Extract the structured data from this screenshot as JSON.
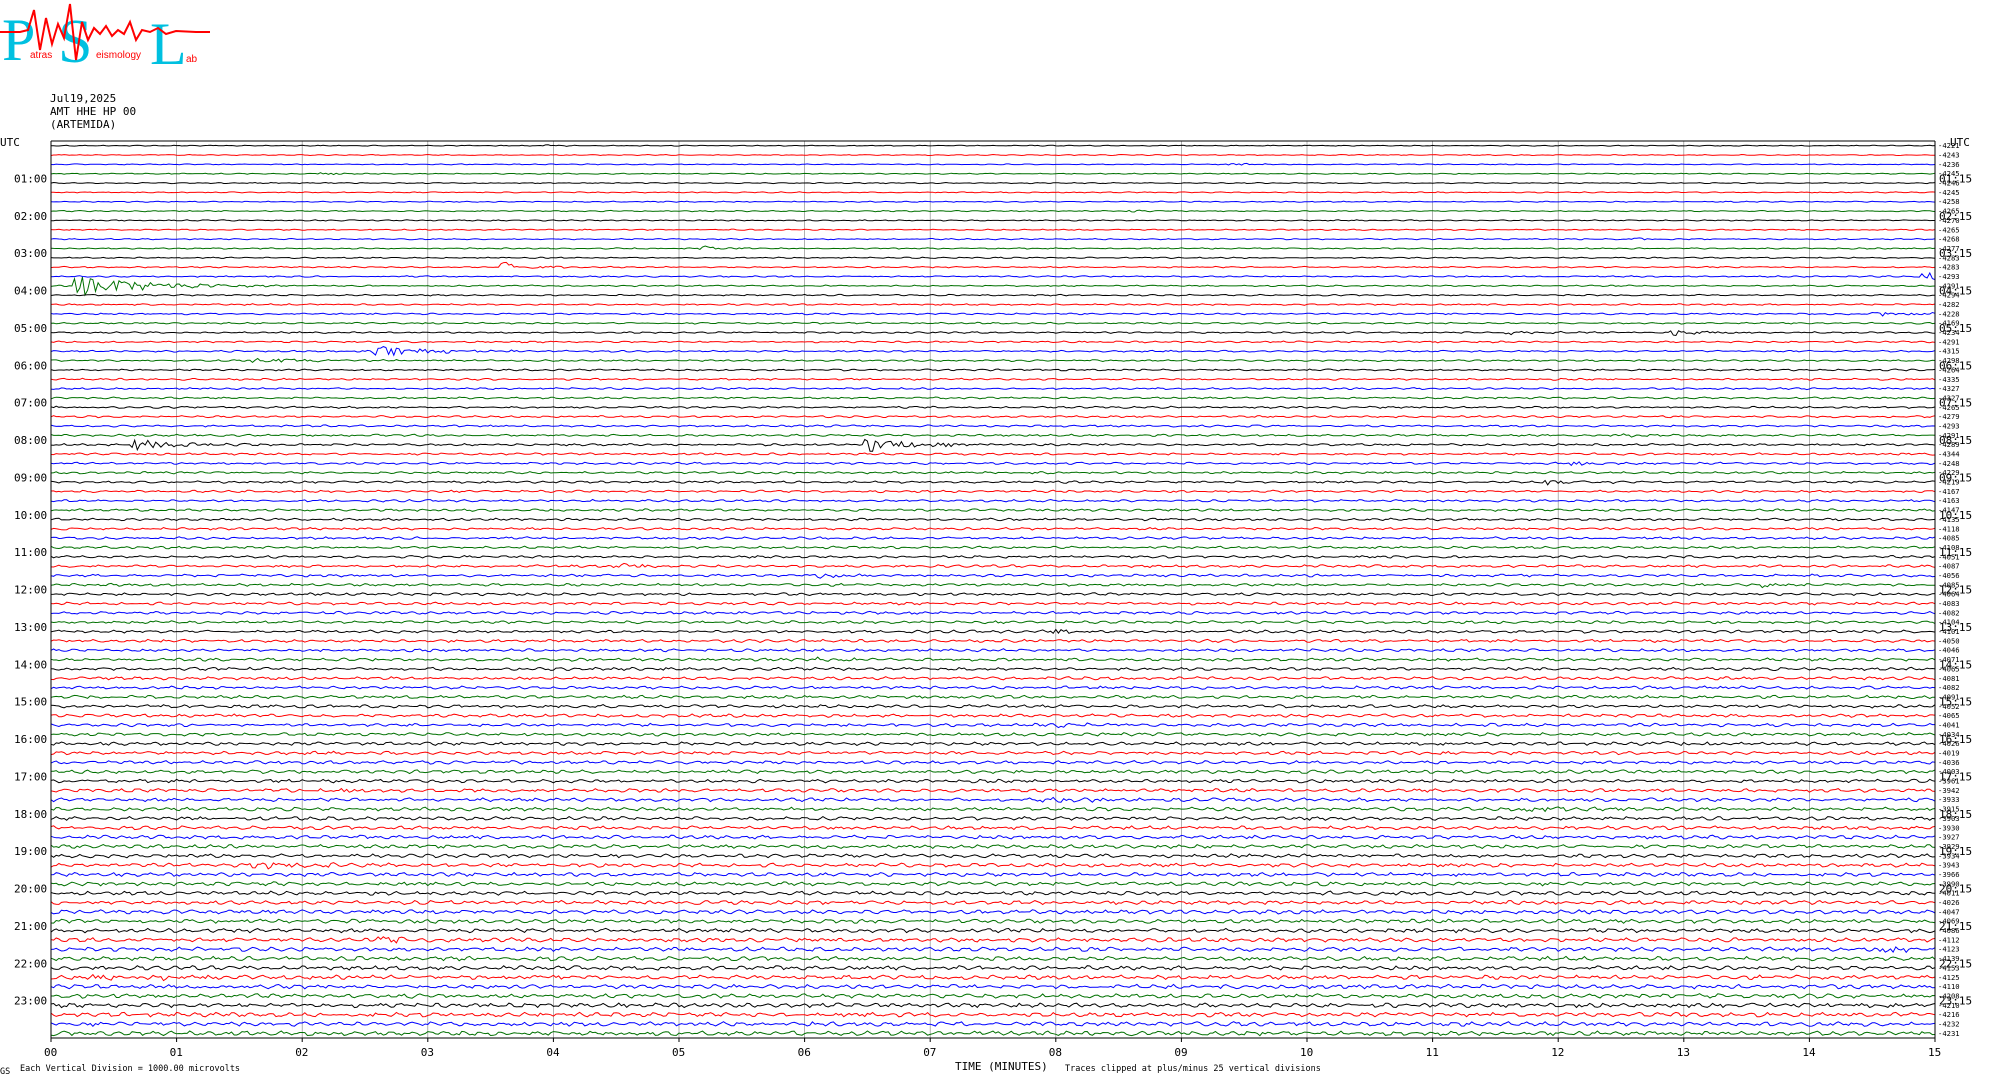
{
  "logo": {
    "big_letters": [
      "P",
      "S",
      "L"
    ],
    "small_words": [
      "atras",
      "eismology",
      "ab"
    ],
    "colors": {
      "p": "#00c0e0",
      "s": "#00c0e0",
      "l": "#00c0e0",
      "wave": "#ff0000",
      "small": "#ff0000"
    }
  },
  "header": {
    "date": "Jul19,2025",
    "station": "AMT HHE HP 00",
    "site": "(ARTEMIDA)"
  },
  "chart_data": {
    "type": "line",
    "title": "",
    "xlabel": "TIME (MINUTES)",
    "xlim": [
      0,
      15
    ],
    "x_ticks": [
      "00",
      "01",
      "02",
      "03",
      "04",
      "05",
      "06",
      "07",
      "08",
      "09",
      "10",
      "11",
      "12",
      "13",
      "14",
      "15"
    ],
    "left_axis_title": "UTC",
    "right_axis_title": "UTC",
    "left_hour_labels": [
      "01:00",
      "02:00",
      "03:00",
      "04:00",
      "05:00",
      "06:00",
      "07:00",
      "08:00",
      "09:00",
      "10:00",
      "11:00",
      "12:00",
      "13:00",
      "14:00",
      "15:00",
      "16:00",
      "17:00",
      "18:00",
      "19:00",
      "20:00",
      "21:00",
      "22:00",
      "23:00"
    ],
    "right_hour_labels": [
      "01:15",
      "02:15",
      "03:15",
      "04:15",
      "05:15",
      "06:15",
      "07:15",
      "08:15",
      "09:15",
      "10:15",
      "11:15",
      "12:15",
      "13:15",
      "14:15",
      "15:15",
      "16:15",
      "17:15",
      "18:15",
      "19:15",
      "20:15",
      "21:15",
      "22:15",
      "23:15"
    ],
    "trace_minutes": 15,
    "trace_color_cycle": [
      "#000000",
      "#ff0000",
      "#0000ff",
      "#007000"
    ],
    "trace_offsets": [
      "-4221",
      "-4243",
      "-4236",
      "-4245",
      "-4246",
      "-4245",
      "-4258",
      "-4265",
      "-4270",
      "-4265",
      "-4268",
      "-4277",
      "-4283",
      "-4283",
      "-4293",
      "-4291",
      "-4294",
      "-4282",
      "-4228",
      "-4169",
      "-4234",
      "-4291",
      "-4315",
      "-4298",
      "-4264",
      "-4335",
      "-4327",
      "-4327",
      "-4265",
      "-4279",
      "-4293",
      "-4291",
      "-4289",
      "-4344",
      "-4248",
      "-4229",
      "-4219",
      "-4167",
      "-4163",
      "-4147",
      "-4135",
      "-4118",
      "-4085",
      "-4108",
      "-4051",
      "-4087",
      "-4056",
      "-4085",
      "-4064",
      "-4083",
      "-4082",
      "-4104",
      "-4101",
      "-4050",
      "-4046",
      "-4071",
      "-4065",
      "-4081",
      "-4082",
      "-4091",
      "-4052",
      "-4065",
      "-4041",
      "-4034",
      "-4026",
      "-4019",
      "-4036",
      "-4003",
      "-3961",
      "-3942",
      "-3933",
      "-3915",
      "-3903",
      "-3930",
      "-3927",
      "-3929",
      "-3934",
      "-3943",
      "-3966",
      "-3990",
      "-4011",
      "-4026",
      "-4047",
      "-4069",
      "-4086",
      "-4112",
      "-4123",
      "-4139",
      "-4153",
      "-4125",
      "-4110",
      "-4208",
      "-4210",
      "-4216",
      "-4232",
      "-4231"
    ],
    "events": [
      {
        "row": 0,
        "minute": 3.95,
        "amp": 1.2,
        "dur": 0.15
      },
      {
        "row": 3,
        "minute": 2.15,
        "amp": 1.4,
        "dur": 0.2
      },
      {
        "row": 2,
        "minute": 9.4,
        "amp": 1.2,
        "dur": 0.2
      },
      {
        "row": 7,
        "minute": 8.6,
        "amp": 1.4,
        "dur": 0.1
      },
      {
        "row": 10,
        "minute": 12.6,
        "amp": 1.6,
        "dur": 0.12
      },
      {
        "row": 11,
        "minute": 5.2,
        "amp": 1.8,
        "dur": 0.3
      },
      {
        "row": 13,
        "minute": 3.6,
        "amp": 5.5,
        "dur": 0.25
      },
      {
        "row": 15,
        "minute": 0.2,
        "amp": 9.0,
        "dur": 0.8
      },
      {
        "row": 14,
        "minute": 14.9,
        "amp": 5.0,
        "dur": 0.2
      },
      {
        "row": 18,
        "minute": 14.5,
        "amp": 2.0,
        "dur": 0.6
      },
      {
        "row": 20,
        "minute": 11.6,
        "amp": 1.8,
        "dur": 0.6
      },
      {
        "row": 20,
        "minute": 12.9,
        "amp": 2.2,
        "dur": 0.5
      },
      {
        "row": 22,
        "minute": 2.6,
        "amp": 4.0,
        "dur": 0.7
      },
      {
        "row": 23,
        "minute": 1.6,
        "amp": 1.8,
        "dur": 0.8
      },
      {
        "row": 32,
        "minute": 0.65,
        "amp": 5.0,
        "dur": 0.5
      },
      {
        "row": 32,
        "minute": 6.5,
        "amp": 7.0,
        "dur": 0.45
      },
      {
        "row": 31,
        "minute": 12.5,
        "amp": 1.6,
        "dur": 0.3
      },
      {
        "row": 34,
        "minute": 12.1,
        "amp": 1.5,
        "dur": 0.4
      },
      {
        "row": 36,
        "minute": 11.9,
        "amp": 2.5,
        "dur": 0.35
      },
      {
        "row": 42,
        "minute": 11.8,
        "amp": 1.3,
        "dur": 0.15
      },
      {
        "row": 45,
        "minute": 4.5,
        "amp": 2.2,
        "dur": 0.35
      },
      {
        "row": 46,
        "minute": 6.1,
        "amp": 2.0,
        "dur": 0.4
      },
      {
        "row": 47,
        "minute": 13.6,
        "amp": 2.5,
        "dur": 0.4
      },
      {
        "row": 52,
        "minute": 7.9,
        "amp": 3.5,
        "dur": 0.35
      },
      {
        "row": 55,
        "minute": 6.1,
        "amp": 1.5,
        "dur": 0.4
      },
      {
        "row": 62,
        "minute": 8.0,
        "amp": 1.5,
        "dur": 0.6
      },
      {
        "row": 64,
        "minute": 12.85,
        "amp": 3.5,
        "dur": 0.25
      },
      {
        "row": 69,
        "minute": 2.35,
        "amp": 1.6,
        "dur": 0.3
      },
      {
        "row": 70,
        "minute": 7.9,
        "amp": 2.0,
        "dur": 0.6
      },
      {
        "row": 71,
        "minute": 11.7,
        "amp": 2.0,
        "dur": 0.6
      },
      {
        "row": 77,
        "minute": 1.6,
        "amp": 2.0,
        "dur": 1.0
      },
      {
        "row": 77,
        "minute": 8.5,
        "amp": 1.2,
        "dur": 0.2
      },
      {
        "row": 85,
        "minute": 2.6,
        "amp": 2.8,
        "dur": 0.3
      },
      {
        "row": 86,
        "minute": 14.5,
        "amp": 2.5,
        "dur": 1.2
      },
      {
        "row": 89,
        "minute": 0.3,
        "amp": 3.0,
        "dur": 0.5
      },
      {
        "row": 89,
        "minute": 0.9,
        "amp": 1.8,
        "dur": 0.4
      },
      {
        "row": 92,
        "minute": 12.1,
        "amp": 2.2,
        "dur": 0.2
      }
    ],
    "footer": {
      "division_note": "Each Vertical Division = 1000.00 microvolts",
      "clip_note": "Traces clipped at plus/minus 25 vertical divisions",
      "corner_mark": "GS"
    }
  }
}
